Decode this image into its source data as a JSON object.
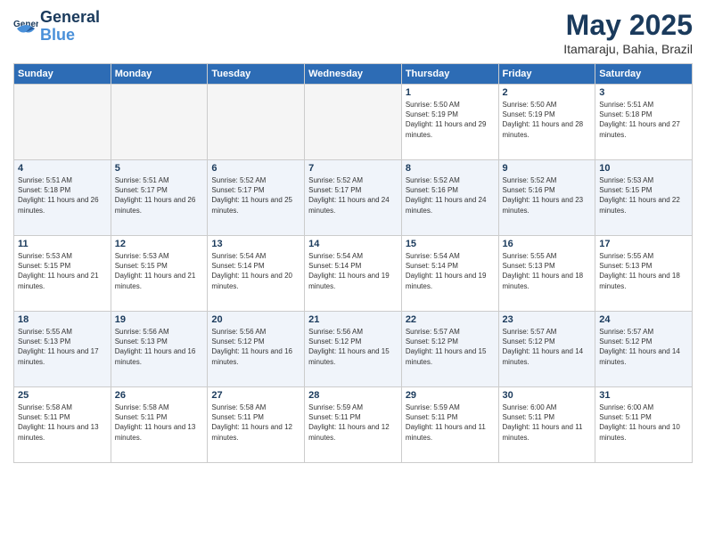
{
  "logo": {
    "line1": "General",
    "line2": "Blue"
  },
  "title": "May 2025",
  "subtitle": "Itamaraju, Bahia, Brazil",
  "weekdays": [
    "Sunday",
    "Monday",
    "Tuesday",
    "Wednesday",
    "Thursday",
    "Friday",
    "Saturday"
  ],
  "weeks": [
    [
      {
        "day": "",
        "empty": true
      },
      {
        "day": "",
        "empty": true
      },
      {
        "day": "",
        "empty": true
      },
      {
        "day": "",
        "empty": true
      },
      {
        "day": "1",
        "sunrise": "5:50 AM",
        "sunset": "5:19 PM",
        "daylight": "11 hours and 29 minutes."
      },
      {
        "day": "2",
        "sunrise": "5:50 AM",
        "sunset": "5:19 PM",
        "daylight": "11 hours and 28 minutes."
      },
      {
        "day": "3",
        "sunrise": "5:51 AM",
        "sunset": "5:18 PM",
        "daylight": "11 hours and 27 minutes."
      }
    ],
    [
      {
        "day": "4",
        "sunrise": "5:51 AM",
        "sunset": "5:18 PM",
        "daylight": "11 hours and 26 minutes."
      },
      {
        "day": "5",
        "sunrise": "5:51 AM",
        "sunset": "5:17 PM",
        "daylight": "11 hours and 26 minutes."
      },
      {
        "day": "6",
        "sunrise": "5:52 AM",
        "sunset": "5:17 PM",
        "daylight": "11 hours and 25 minutes."
      },
      {
        "day": "7",
        "sunrise": "5:52 AM",
        "sunset": "5:17 PM",
        "daylight": "11 hours and 24 minutes."
      },
      {
        "day": "8",
        "sunrise": "5:52 AM",
        "sunset": "5:16 PM",
        "daylight": "11 hours and 24 minutes."
      },
      {
        "day": "9",
        "sunrise": "5:52 AM",
        "sunset": "5:16 PM",
        "daylight": "11 hours and 23 minutes."
      },
      {
        "day": "10",
        "sunrise": "5:53 AM",
        "sunset": "5:15 PM",
        "daylight": "11 hours and 22 minutes."
      }
    ],
    [
      {
        "day": "11",
        "sunrise": "5:53 AM",
        "sunset": "5:15 PM",
        "daylight": "11 hours and 21 minutes."
      },
      {
        "day": "12",
        "sunrise": "5:53 AM",
        "sunset": "5:15 PM",
        "daylight": "11 hours and 21 minutes."
      },
      {
        "day": "13",
        "sunrise": "5:54 AM",
        "sunset": "5:14 PM",
        "daylight": "11 hours and 20 minutes."
      },
      {
        "day": "14",
        "sunrise": "5:54 AM",
        "sunset": "5:14 PM",
        "daylight": "11 hours and 19 minutes."
      },
      {
        "day": "15",
        "sunrise": "5:54 AM",
        "sunset": "5:14 PM",
        "daylight": "11 hours and 19 minutes."
      },
      {
        "day": "16",
        "sunrise": "5:55 AM",
        "sunset": "5:13 PM",
        "daylight": "11 hours and 18 minutes."
      },
      {
        "day": "17",
        "sunrise": "5:55 AM",
        "sunset": "5:13 PM",
        "daylight": "11 hours and 18 minutes."
      }
    ],
    [
      {
        "day": "18",
        "sunrise": "5:55 AM",
        "sunset": "5:13 PM",
        "daylight": "11 hours and 17 minutes."
      },
      {
        "day": "19",
        "sunrise": "5:56 AM",
        "sunset": "5:13 PM",
        "daylight": "11 hours and 16 minutes."
      },
      {
        "day": "20",
        "sunrise": "5:56 AM",
        "sunset": "5:12 PM",
        "daylight": "11 hours and 16 minutes."
      },
      {
        "day": "21",
        "sunrise": "5:56 AM",
        "sunset": "5:12 PM",
        "daylight": "11 hours and 15 minutes."
      },
      {
        "day": "22",
        "sunrise": "5:57 AM",
        "sunset": "5:12 PM",
        "daylight": "11 hours and 15 minutes."
      },
      {
        "day": "23",
        "sunrise": "5:57 AM",
        "sunset": "5:12 PM",
        "daylight": "11 hours and 14 minutes."
      },
      {
        "day": "24",
        "sunrise": "5:57 AM",
        "sunset": "5:12 PM",
        "daylight": "11 hours and 14 minutes."
      }
    ],
    [
      {
        "day": "25",
        "sunrise": "5:58 AM",
        "sunset": "5:11 PM",
        "daylight": "11 hours and 13 minutes."
      },
      {
        "day": "26",
        "sunrise": "5:58 AM",
        "sunset": "5:11 PM",
        "daylight": "11 hours and 13 minutes."
      },
      {
        "day": "27",
        "sunrise": "5:58 AM",
        "sunset": "5:11 PM",
        "daylight": "11 hours and 12 minutes."
      },
      {
        "day": "28",
        "sunrise": "5:59 AM",
        "sunset": "5:11 PM",
        "daylight": "11 hours and 12 minutes."
      },
      {
        "day": "29",
        "sunrise": "5:59 AM",
        "sunset": "5:11 PM",
        "daylight": "11 hours and 11 minutes."
      },
      {
        "day": "30",
        "sunrise": "6:00 AM",
        "sunset": "5:11 PM",
        "daylight": "11 hours and 11 minutes."
      },
      {
        "day": "31",
        "sunrise": "6:00 AM",
        "sunset": "5:11 PM",
        "daylight": "11 hours and 10 minutes."
      }
    ]
  ]
}
